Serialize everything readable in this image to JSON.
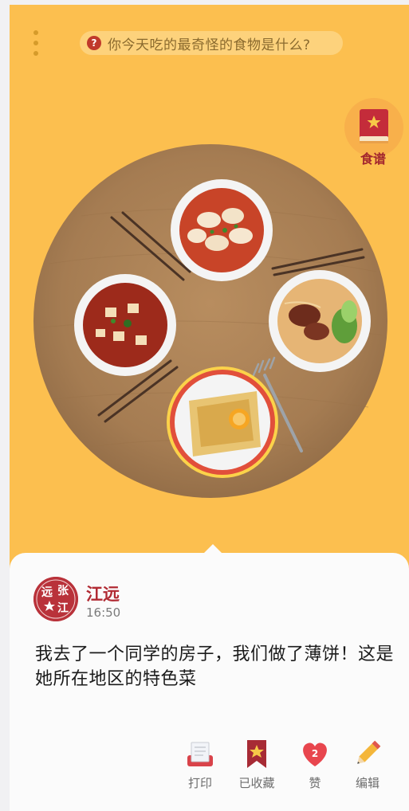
{
  "header": {
    "question": "你今天吃的最奇怪的食物是什么?"
  },
  "recipe_button": {
    "label": "食谱"
  },
  "table": {
    "dishes": [
      "dumplings-in-chili-oil",
      "beef-noodle-soup",
      "crepes",
      "mapo-tofu"
    ]
  },
  "post": {
    "author": "江远",
    "avatar_text": "远张江",
    "time": "16:50",
    "text": "我去了一个同学的房子，我们做了薄饼！这是她所在地区的特色菜"
  },
  "actions": {
    "print_label": "打印",
    "collected_label": "已收藏",
    "like_label": "赞",
    "like_count": "2",
    "edit_label": "编辑"
  },
  "colors": {
    "background": "#fcbf4f",
    "accent": "#b12a33",
    "card": "#fbfbfb"
  }
}
